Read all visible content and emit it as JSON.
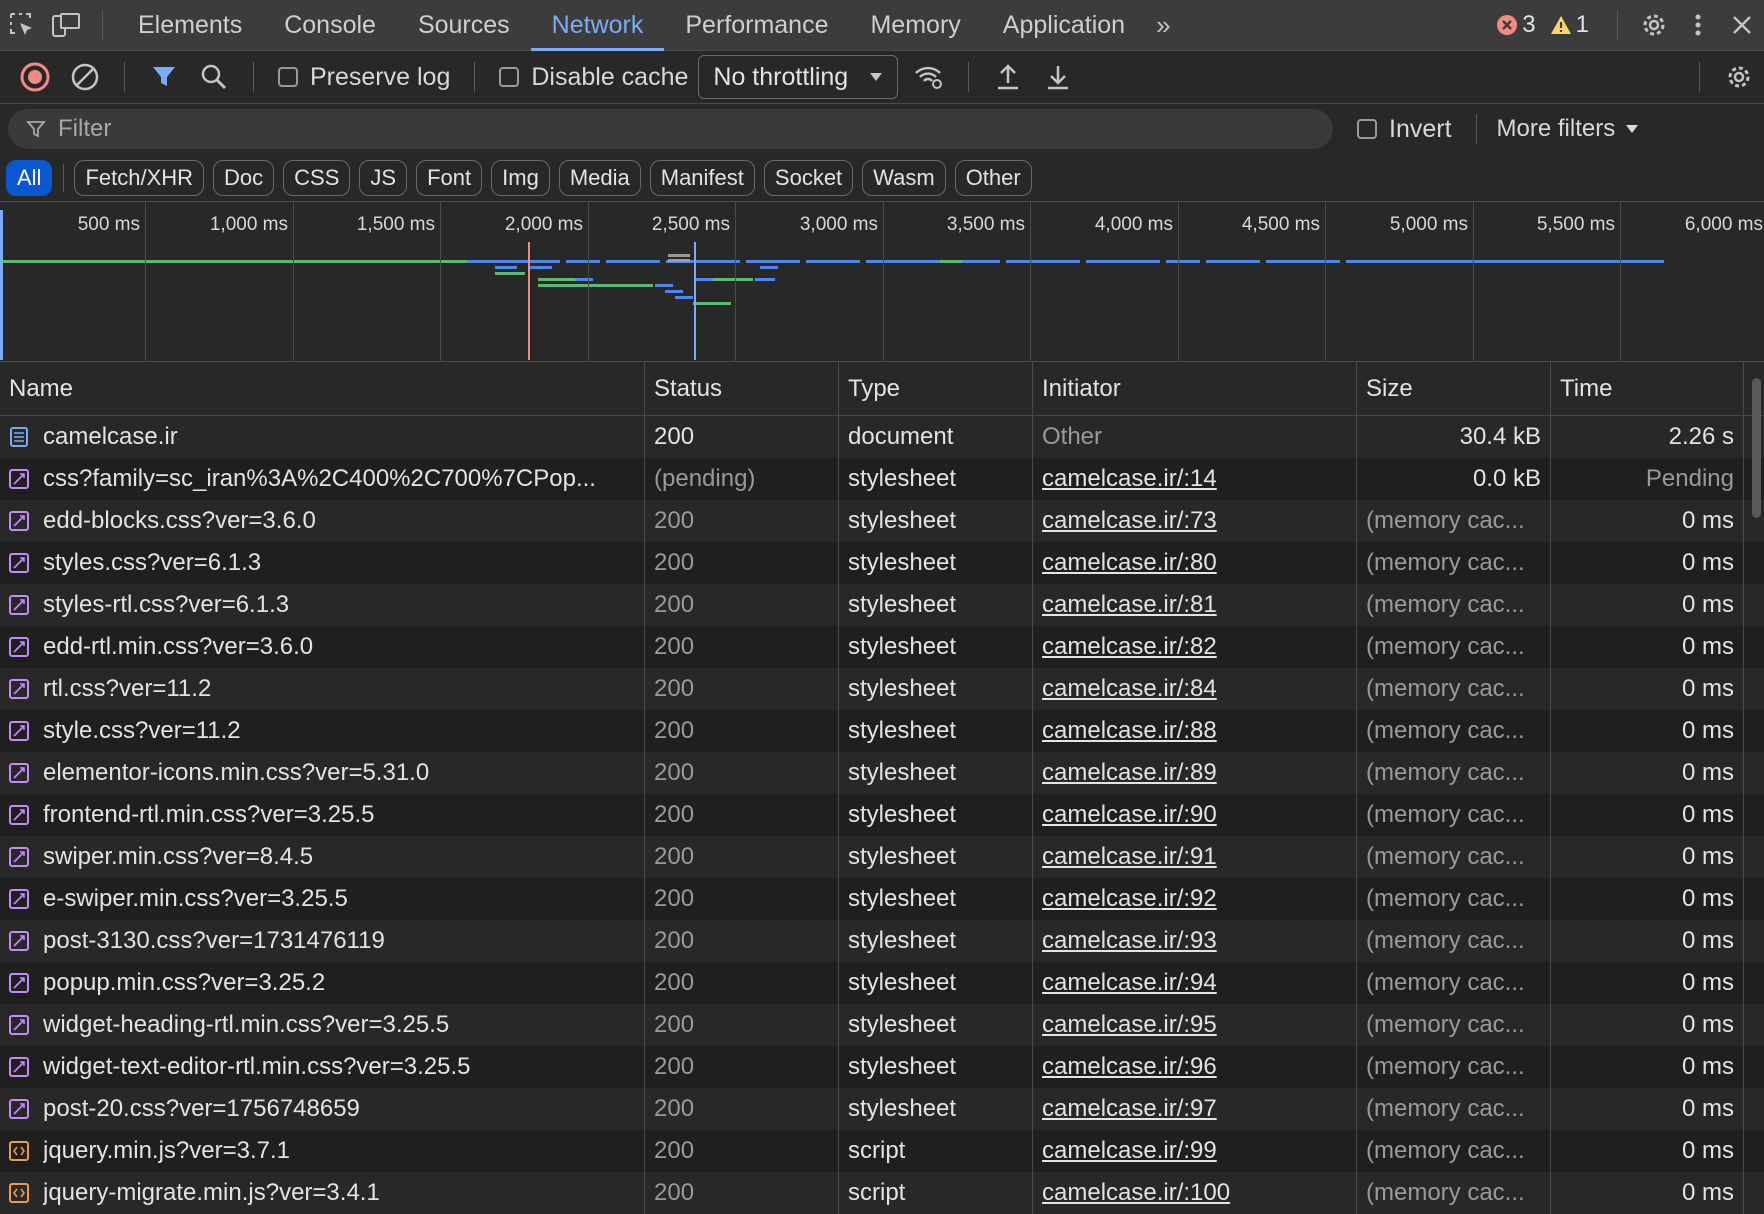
{
  "tabs": [
    "Elements",
    "Console",
    "Sources",
    "Network",
    "Performance",
    "Memory",
    "Application"
  ],
  "active_tab": "Network",
  "errors_count": "3",
  "warnings_count": "1",
  "toolbar": {
    "preserve_log": "Preserve log",
    "disable_cache": "Disable cache",
    "throttling": "No throttling"
  },
  "filter": {
    "placeholder": "Filter",
    "invert": "Invert",
    "more_filters": "More filters"
  },
  "type_filters": [
    "All",
    "Fetch/XHR",
    "Doc",
    "CSS",
    "JS",
    "Font",
    "Img",
    "Media",
    "Manifest",
    "Socket",
    "Wasm",
    "Other"
  ],
  "timeline_ticks": [
    "500 ms",
    "1,000 ms",
    "1,500 ms",
    "2,000 ms",
    "2,500 ms",
    "3,000 ms",
    "3,500 ms",
    "4,000 ms",
    "4,500 ms",
    "5,000 ms",
    "5,500 ms",
    "6,000 ms"
  ],
  "columns": [
    "Name",
    "Status",
    "Type",
    "Initiator",
    "Size",
    "Time"
  ],
  "requests": [
    {
      "name": "camelcase.ir",
      "status": "200",
      "type": "document",
      "initiator": "Other",
      "size": "30.4 kB",
      "time": "2.26 s",
      "kind": "doc"
    },
    {
      "name": "css?family=sc_iran%3A%2C400%2C700%7CPop...",
      "status": "(pending)",
      "type": "stylesheet",
      "initiator": "camelcase.ir/:14",
      "size": "0.0 kB",
      "time": "Pending",
      "kind": "css"
    },
    {
      "name": "edd-blocks.css?ver=3.6.0",
      "status": "200",
      "type": "stylesheet",
      "initiator": "camelcase.ir/:73",
      "size": "(memory cac...",
      "time": "0 ms",
      "kind": "css"
    },
    {
      "name": "styles.css?ver=6.1.3",
      "status": "200",
      "type": "stylesheet",
      "initiator": "camelcase.ir/:80",
      "size": "(memory cac...",
      "time": "0 ms",
      "kind": "css"
    },
    {
      "name": "styles-rtl.css?ver=6.1.3",
      "status": "200",
      "type": "stylesheet",
      "initiator": "camelcase.ir/:81",
      "size": "(memory cac...",
      "time": "0 ms",
      "kind": "css"
    },
    {
      "name": "edd-rtl.min.css?ver=3.6.0",
      "status": "200",
      "type": "stylesheet",
      "initiator": "camelcase.ir/:82",
      "size": "(memory cac...",
      "time": "0 ms",
      "kind": "css"
    },
    {
      "name": "rtl.css?ver=11.2",
      "status": "200",
      "type": "stylesheet",
      "initiator": "camelcase.ir/:84",
      "size": "(memory cac...",
      "time": "0 ms",
      "kind": "css"
    },
    {
      "name": "style.css?ver=11.2",
      "status": "200",
      "type": "stylesheet",
      "initiator": "camelcase.ir/:88",
      "size": "(memory cac...",
      "time": "0 ms",
      "kind": "css"
    },
    {
      "name": "elementor-icons.min.css?ver=5.31.0",
      "status": "200",
      "type": "stylesheet",
      "initiator": "camelcase.ir/:89",
      "size": "(memory cac...",
      "time": "0 ms",
      "kind": "css"
    },
    {
      "name": "frontend-rtl.min.css?ver=3.25.5",
      "status": "200",
      "type": "stylesheet",
      "initiator": "camelcase.ir/:90",
      "size": "(memory cac...",
      "time": "0 ms",
      "kind": "css"
    },
    {
      "name": "swiper.min.css?ver=8.4.5",
      "status": "200",
      "type": "stylesheet",
      "initiator": "camelcase.ir/:91",
      "size": "(memory cac...",
      "time": "0 ms",
      "kind": "css"
    },
    {
      "name": "e-swiper.min.css?ver=3.25.5",
      "status": "200",
      "type": "stylesheet",
      "initiator": "camelcase.ir/:92",
      "size": "(memory cac...",
      "time": "0 ms",
      "kind": "css"
    },
    {
      "name": "post-3130.css?ver=1731476119",
      "status": "200",
      "type": "stylesheet",
      "initiator": "camelcase.ir/:93",
      "size": "(memory cac...",
      "time": "0 ms",
      "kind": "css"
    },
    {
      "name": "popup.min.css?ver=3.25.2",
      "status": "200",
      "type": "stylesheet",
      "initiator": "camelcase.ir/:94",
      "size": "(memory cac...",
      "time": "0 ms",
      "kind": "css"
    },
    {
      "name": "widget-heading-rtl.min.css?ver=3.25.5",
      "status": "200",
      "type": "stylesheet",
      "initiator": "camelcase.ir/:95",
      "size": "(memory cac...",
      "time": "0 ms",
      "kind": "css"
    },
    {
      "name": "widget-text-editor-rtl.min.css?ver=3.25.5",
      "status": "200",
      "type": "stylesheet",
      "initiator": "camelcase.ir/:96",
      "size": "(memory cac...",
      "time": "0 ms",
      "kind": "css"
    },
    {
      "name": "post-20.css?ver=1756748659",
      "status": "200",
      "type": "stylesheet",
      "initiator": "camelcase.ir/:97",
      "size": "(memory cac...",
      "time": "0 ms",
      "kind": "css"
    },
    {
      "name": "jquery.min.js?ver=3.7.1",
      "status": "200",
      "type": "script",
      "initiator": "camelcase.ir/:99",
      "size": "(memory cac...",
      "time": "0 ms",
      "kind": "js"
    },
    {
      "name": "jquery-migrate.min.js?ver=3.4.1",
      "status": "200",
      "type": "script",
      "initiator": "camelcase.ir/:100",
      "size": "(memory cac...",
      "time": "0 ms",
      "kind": "js"
    }
  ],
  "colors": {
    "accent": "#7cacf8",
    "doc_icon": "#7cacf8",
    "css_icon": "#c58af9",
    "js_icon": "#ee9a4d",
    "error": "#f28b82",
    "warning": "#fdd663"
  }
}
